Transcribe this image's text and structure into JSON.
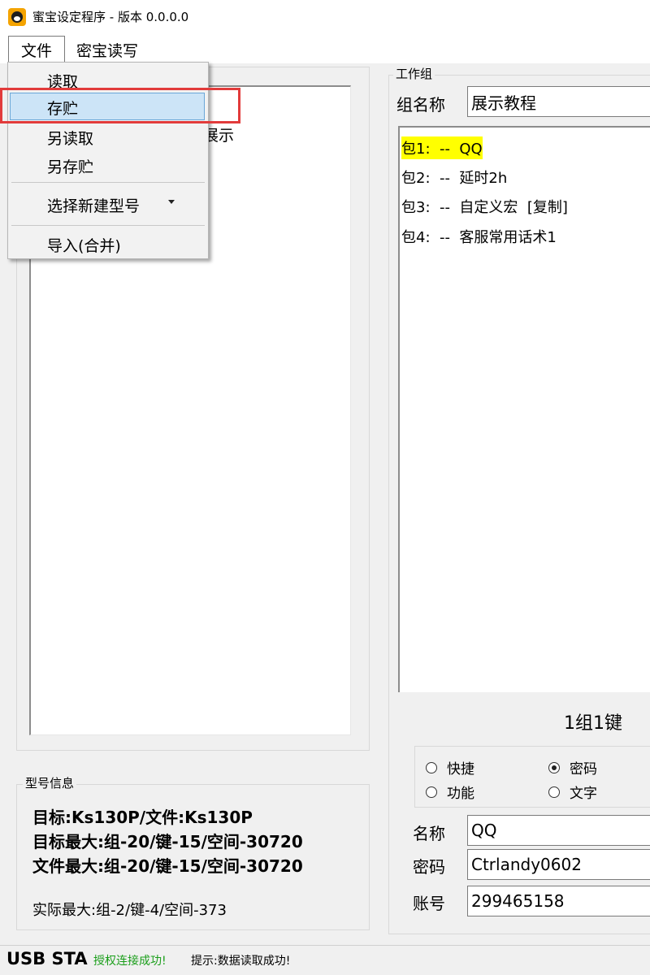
{
  "window": {
    "title": "蜜宝设定程序 - 版本 0.0.0.0"
  },
  "menubar": {
    "file": "文件",
    "read_write": "密宝读写"
  },
  "file_menu": {
    "items": [
      "读取",
      "存贮",
      "另读取",
      "另存贮",
      "选择新建型号",
      "导入(合并)"
    ],
    "highlighted": "存贮"
  },
  "left": {
    "visible_item_fragment": "展示"
  },
  "model_info": {
    "legend": "型号信息",
    "target": "目标:Ks130P/文件:Ks130P",
    "target_max": "目标最大:组-20/键-15/空间-30720",
    "file_max": "文件最大:组-20/键-15/空间-30720",
    "actual_max": "实际最大:组-2/键-4/空间-373"
  },
  "workgroup": {
    "legend": "工作组",
    "group_name_label": "组名称",
    "group_name_value": "展示教程",
    "packets": [
      {
        "label": "包1:  --  QQ",
        "selected": true
      },
      {
        "label": "包2:  --  延时2h",
        "selected": false
      },
      {
        "label": "包3:  --  自定义宏  [复制]",
        "selected": false
      },
      {
        "label": "包4:  --  客服常用话术1",
        "selected": false
      }
    ],
    "key_count": "1组1键",
    "radio": {
      "shortcut": "快捷",
      "password": "密码",
      "function": "功能",
      "text": "文字",
      "selected": "密码"
    },
    "fields": {
      "name_label": "名称",
      "name_value": "QQ",
      "password_label": "密码",
      "password_value": "Ctrlandy0602",
      "account_label": "账号",
      "account_value": "299465158"
    }
  },
  "statusbar": {
    "usb": "USB STA",
    "auth": "授权连接成功!",
    "tip": "提示:数据读取成功!"
  },
  "colors": {
    "highlight": "#cce4f7",
    "selected_packet": "#ffff00",
    "annotation": "#e23b3b",
    "auth_green": "#1a9e1a"
  }
}
